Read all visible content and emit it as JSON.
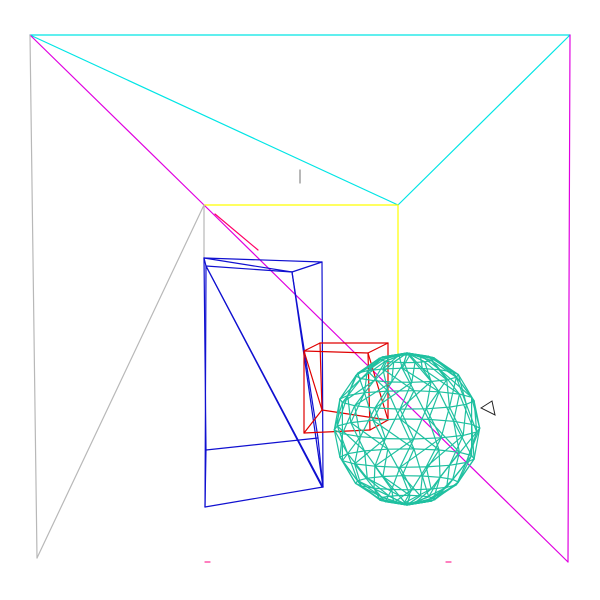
{
  "scene": {
    "background": "#ffffff",
    "colors": {
      "room_ceiling": "#00e5e5",
      "room_right_wall": "#e000e0",
      "room_left_wall": "#b8b8b8",
      "back_wall": "#ffff00",
      "diagonal_beam": "#ff0066",
      "tall_box": "#1010d0",
      "small_cube": "#e00000",
      "sphere": "#1fc0a0",
      "marker": "#222222",
      "floor_ticks": "#ff3399"
    },
    "icons": {
      "player_marker": "triangle-icon",
      "crosshair": "crosshair-icon"
    }
  }
}
